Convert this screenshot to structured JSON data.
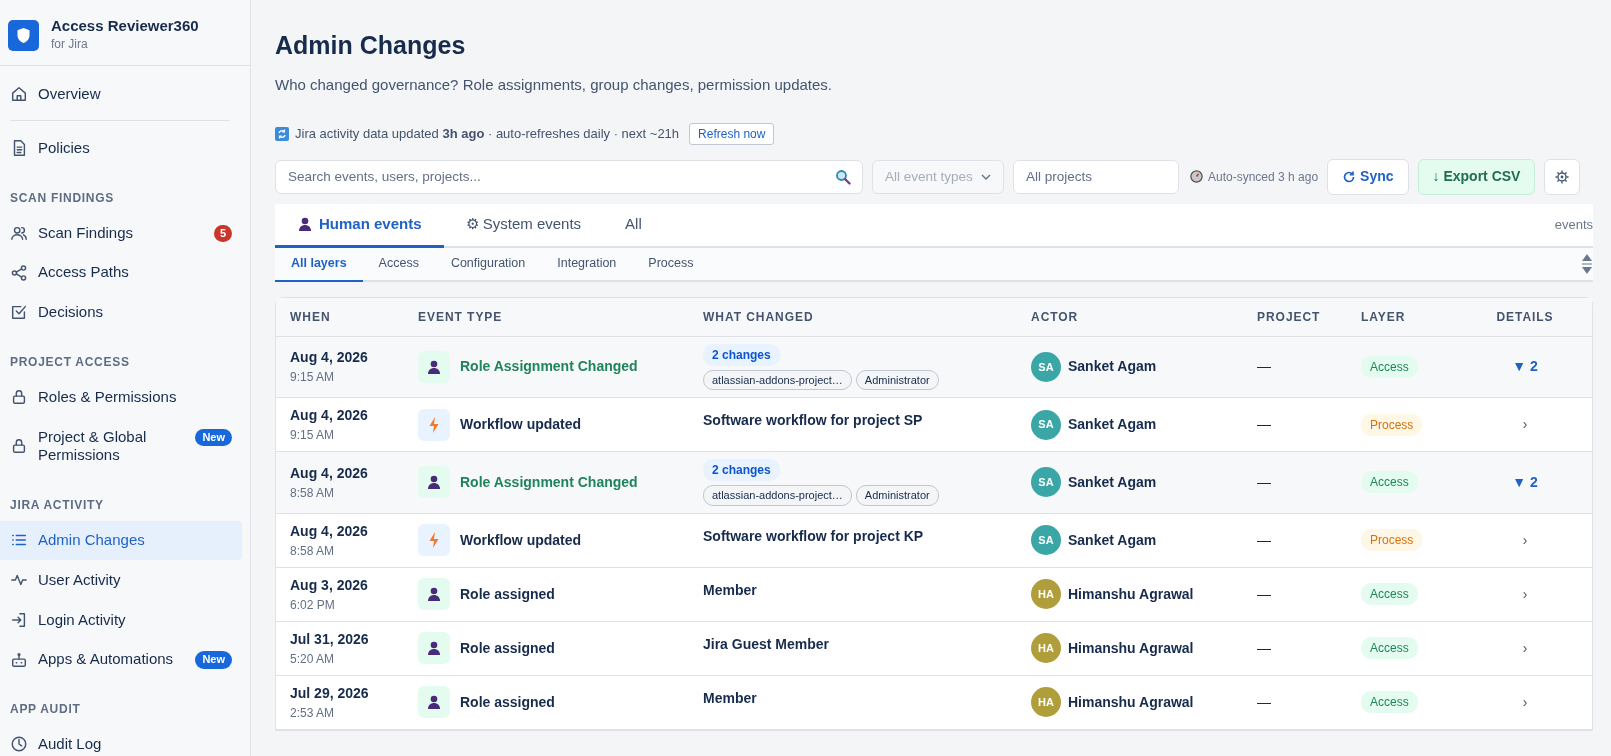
{
  "app": {
    "name": "Access Reviewer360",
    "subtitle": "for Jira"
  },
  "sidebar": {
    "top_items": [
      {
        "label": "Overview",
        "selected": false
      },
      {
        "label": "Policies",
        "selected": false
      }
    ],
    "sections": [
      {
        "heading": "SCAN FINDINGS",
        "items": [
          {
            "label": "Scan Findings",
            "selected": false,
            "badge": {
              "text": "5",
              "kind": "count"
            }
          },
          {
            "label": "Access Paths",
            "selected": false
          },
          {
            "label": "Decisions",
            "selected": false
          }
        ]
      },
      {
        "heading": "PROJECT ACCESS",
        "items": [
          {
            "label": "Roles & Permissions",
            "selected": false
          },
          {
            "label": "Project & Global Permissions",
            "selected": false,
            "badge": {
              "text": "New",
              "kind": "new"
            }
          }
        ]
      },
      {
        "heading": "JIRA ACTIVITY",
        "items": [
          {
            "label": "Admin Changes",
            "selected": true
          },
          {
            "label": "User Activity",
            "selected": false
          },
          {
            "label": "Login Activity",
            "selected": false
          },
          {
            "label": "Apps & Automations",
            "selected": false,
            "badge": {
              "text": "New",
              "kind": "new"
            }
          }
        ]
      },
      {
        "heading": "APP AUDIT",
        "items": [
          {
            "label": "Audit Log",
            "selected": false
          }
        ]
      }
    ]
  },
  "page": {
    "title": "Admin Changes",
    "subtitle": "Who changed governance? Role assignments, group changes, permission updates."
  },
  "sync_notice": {
    "text": "Jira activity data updated **3h ago** · auto-refreshes daily · next ~21h",
    "button": "Refresh now"
  },
  "toolbar": {
    "search": {
      "placeholder": "Search events, users, projects..."
    },
    "event_type": {
      "placeholder": "All event types"
    },
    "projects": {
      "placeholder": "All projects"
    },
    "auto_synced": "Auto-synced 3 h ago",
    "sync_button": "Sync",
    "export_button": "↓ Export CSV"
  },
  "tabs": [
    {
      "label": "Human events",
      "selected": true
    },
    {
      "label": "⚙ System events",
      "selected": false
    },
    {
      "label": "All",
      "selected": false
    }
  ],
  "tabs_note": "events",
  "layer_tabs": [
    {
      "label": "All layers",
      "selected": true
    },
    {
      "label": "Access",
      "selected": false
    },
    {
      "label": "Configuration",
      "selected": false
    },
    {
      "label": "Integration",
      "selected": false
    },
    {
      "label": "Process",
      "selected": false
    }
  ],
  "table": {
    "columns": [
      "WHEN",
      "EVENT TYPE",
      "WHAT CHANGED",
      "ACTOR",
      "PROJECT",
      "LAYER",
      "DETAILS"
    ],
    "rows": [
      {
        "date": "Aug 4, 2026",
        "time": "9:15 AM",
        "expanded": true,
        "event": {
          "label": "Role Assignment Changed",
          "kind": "role_change"
        },
        "what_changed": {
          "summary": "2 changes",
          "tags": [
            "atlassian-addons-project…",
            "Administrator"
          ]
        },
        "actor": {
          "initials": "SA",
          "name": "Sanket Agam",
          "color": "#3aa6a6"
        },
        "project": "—",
        "layer": {
          "label": "Access",
          "kind": "access"
        },
        "details": "▼ 2"
      },
      {
        "date": "Aug 4, 2026",
        "time": "9:15 AM",
        "expanded": false,
        "event": {
          "label": "Workflow updated",
          "kind": "workflow"
        },
        "what_changed": {
          "text": "Software workflow for project SP"
        },
        "actor": {
          "initials": "SA",
          "name": "Sanket Agam",
          "color": "#3aa6a6"
        },
        "project": "—",
        "layer": {
          "label": "Process",
          "kind": "process"
        },
        "details": "›"
      },
      {
        "date": "Aug 4, 2026",
        "time": "8:58 AM",
        "expanded": true,
        "event": {
          "label": "Role Assignment Changed",
          "kind": "role_change"
        },
        "what_changed": {
          "summary": "2 changes",
          "tags": [
            "atlassian-addons-project…",
            "Administrator"
          ]
        },
        "actor": {
          "initials": "SA",
          "name": "Sanket Agam",
          "color": "#3aa6a6"
        },
        "project": "—",
        "layer": {
          "label": "Access",
          "kind": "access"
        },
        "details": "▼ 2"
      },
      {
        "date": "Aug 4, 2026",
        "time": "8:58 AM",
        "expanded": false,
        "event": {
          "label": "Workflow updated",
          "kind": "workflow"
        },
        "what_changed": {
          "text": "Software workflow for project KP"
        },
        "actor": {
          "initials": "SA",
          "name": "Sanket Agam",
          "color": "#3aa6a6"
        },
        "project": "—",
        "layer": {
          "label": "Process",
          "kind": "process"
        },
        "details": "›"
      },
      {
        "date": "Aug 3, 2026",
        "time": "6:02 PM",
        "expanded": false,
        "event": {
          "label": "Role assigned",
          "kind": "role_assigned"
        },
        "what_changed": {
          "text": "Member"
        },
        "actor": {
          "initials": "HA",
          "name": "Himanshu Agrawal",
          "color": "#b09e3a"
        },
        "project": "—",
        "layer": {
          "label": "Access",
          "kind": "access"
        },
        "details": "›"
      },
      {
        "date": "Jul 31, 2026",
        "time": "5:20 AM",
        "expanded": false,
        "event": {
          "label": "Role assigned",
          "kind": "role_assigned"
        },
        "what_changed": {
          "text": "Jira Guest Member"
        },
        "actor": {
          "initials": "HA",
          "name": "Himanshu Agrawal",
          "color": "#b09e3a"
        },
        "project": "—",
        "layer": {
          "label": "Access",
          "kind": "access"
        },
        "details": "›"
      },
      {
        "date": "Jul 29, 2026",
        "time": "2:53 AM",
        "expanded": false,
        "event": {
          "label": "Role assigned",
          "kind": "role_assigned"
        },
        "what_changed": {
          "text": "Member"
        },
        "actor": {
          "initials": "HA",
          "name": "Himanshu Agrawal",
          "color": "#b09e3a"
        },
        "project": "—",
        "layer": {
          "label": "Access",
          "kind": "access"
        },
        "details": "›"
      }
    ]
  }
}
